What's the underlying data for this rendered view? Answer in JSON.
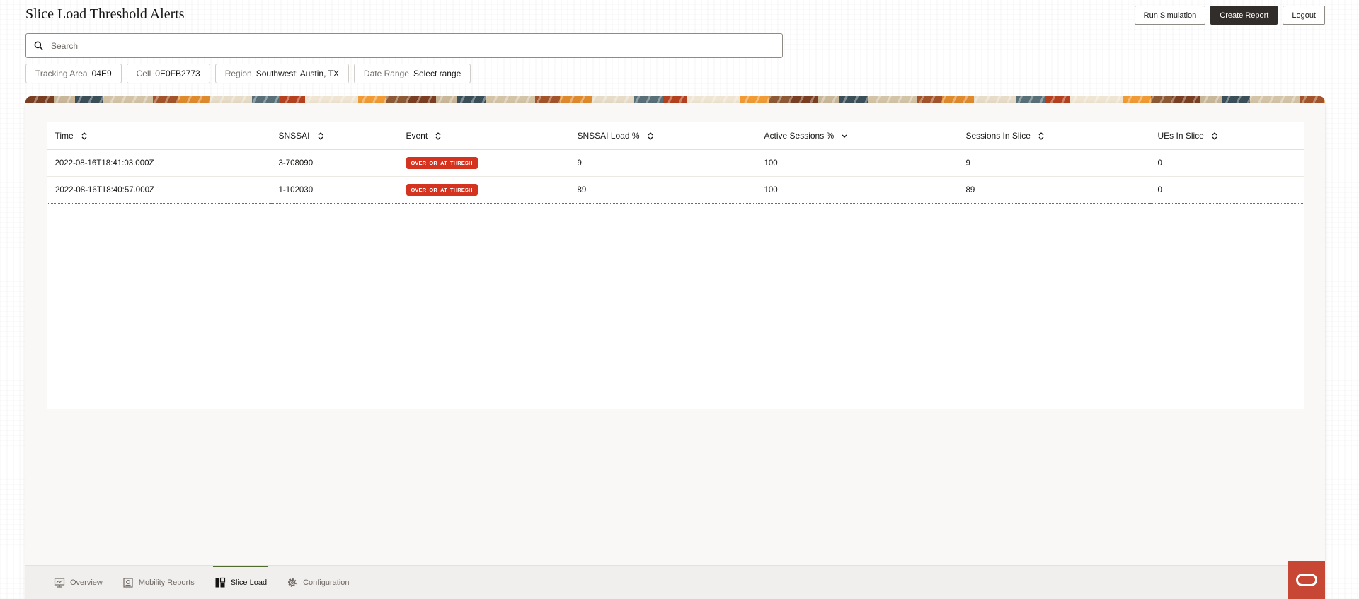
{
  "page": {
    "title": "Slice Load Threshold Alerts"
  },
  "actions": {
    "run_simulation": "Run Simulation",
    "create_report": "Create Report",
    "logout": "Logout"
  },
  "search": {
    "placeholder": "Search",
    "value": ""
  },
  "filters": [
    {
      "label": "Tracking Area",
      "value": "04E9"
    },
    {
      "label": "Cell",
      "value": "0E0FB2773"
    },
    {
      "label": "Region",
      "value": "Southwest: Austin, TX"
    },
    {
      "label": "Date Range",
      "value": "Select range"
    }
  ],
  "table": {
    "columns": [
      "Time",
      "SNSSAI",
      "Event",
      "SNSSAI Load %",
      "Active Sessions %",
      "Sessions In Slice",
      "UEs In Slice"
    ],
    "sorted_column": "Active Sessions %",
    "rows": [
      {
        "time": "2022-08-16T18:41:03.000Z",
        "snssai": "3-708090",
        "event": "OVER_OR_AT_THRESH",
        "snssai_load": "9",
        "active_sessions": "100",
        "sessions_in_slice": "9",
        "ues_in_slice": "0"
      },
      {
        "time": "2022-08-16T18:40:57.000Z",
        "snssai": "1-102030",
        "event": "OVER_OR_AT_THRESH",
        "snssai_load": "89",
        "active_sessions": "100",
        "sessions_in_slice": "89",
        "ues_in_slice": "0"
      }
    ]
  },
  "nav": {
    "items": [
      {
        "label": "Overview",
        "icon": "monitor-icon"
      },
      {
        "label": "Mobility Reports",
        "icon": "report-icon"
      },
      {
        "label": "Slice Load",
        "icon": "slice-load-icon",
        "active": true
      },
      {
        "label": "Configuration",
        "icon": "gear-icon"
      }
    ]
  },
  "colors": {
    "accent_dark": "#312d2a",
    "badge_red": "#d4331f",
    "brand_red": "#c74634",
    "active_tab": "#4f6b2e"
  }
}
